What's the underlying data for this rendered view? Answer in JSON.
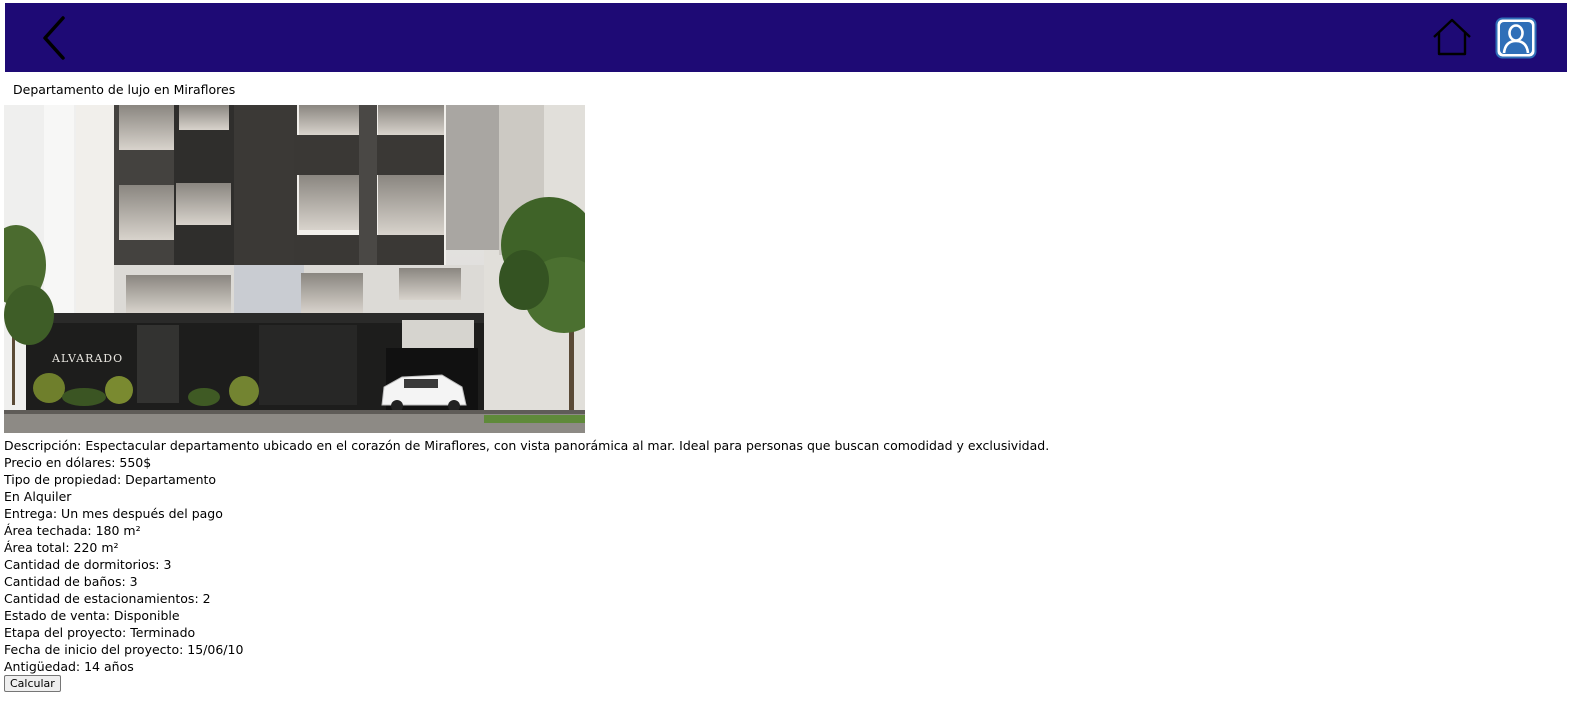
{
  "header": {
    "background": "#1e0a75",
    "back_icon": "chevron-left-icon",
    "home_icon": "home-icon",
    "profile_icon": "user-profile-icon"
  },
  "property": {
    "title": "Departamento de lujo en Miraflores",
    "image_alt": "Fachada del edificio Residencial Alvarado",
    "image_sign": "ALVARADO",
    "description": "Descripción: Espectacular departamento ubicado en el corazón de Miraflores, con vista panorámica al mar. Ideal para personas que buscan comodidad y exclusividad.",
    "price": "Precio en dólares: 550$",
    "type": "Tipo de propiedad: Departamento",
    "mode": "En Alquiler",
    "delivery": "Entrega: Un mes después del pago",
    "covered_area": "Área techada: 180 m²",
    "total_area": "Área total: 220 m²",
    "bedrooms": "Cantidad de dormitorios: 3",
    "bathrooms": "Cantidad de baños: 3",
    "parking": "Cantidad de estacionamientos: 2",
    "sale_status": "Estado de venta: Disponible",
    "project_stage": "Etapa del proyecto: Terminado",
    "start_date": "Fecha de inicio del proyecto: 15/06/10",
    "age": "Antigüedad: 14 años"
  },
  "actions": {
    "calculate_label": "Calcular"
  }
}
